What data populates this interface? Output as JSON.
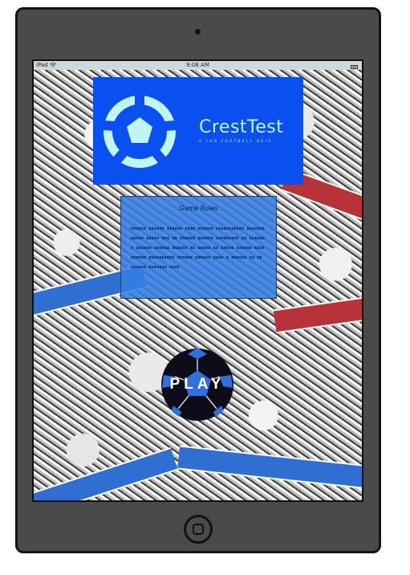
{
  "status_bar": {
    "device": "iPad",
    "wifi_icon": "wifi-icon",
    "time": "9:08 AM",
    "battery_icon": "battery-icon"
  },
  "brand": {
    "title": "CrestTest",
    "tagline": "A FUN FOOTBALL QUIZ",
    "logo_icon": "football-icon",
    "colors": {
      "box": "#0a4ff0",
      "accent": "#bff5f3"
    }
  },
  "rules": {
    "title": "Game Rules",
    "body": "xxxxxx xxxxxx xxxxxx xxxx xxxxxx xxxxxxxxxxx xxxxxxxxxxxx xxxxx xxx xx xxxxxx xxxxxx xxxxxxxxx xx xxxxxx x xxxxxx xxxxxx xxxxxx xx xxxxx xx xxxxx xxxxxx xxxx xxxxxx xxxxxxxxxx xxxxxx xxxxxx xxxx x xxxxxx xx xx xxxxxx xxxxxxx xxxx",
    "colors": {
      "box": "#367ee2"
    }
  },
  "play": {
    "label": "PLAY",
    "icon": "football-icon",
    "colors": {
      "dark": "#0d0d1a",
      "light": "#2f6fe0"
    }
  },
  "device_controls": {
    "home_icon": "home-button-icon"
  }
}
